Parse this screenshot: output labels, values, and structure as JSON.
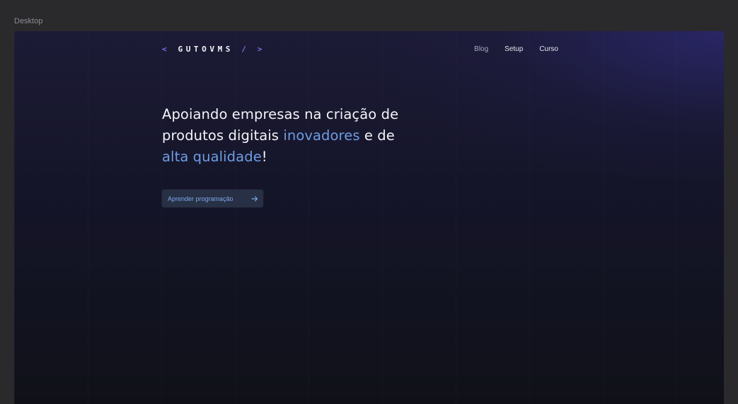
{
  "frame": {
    "label": "Desktop"
  },
  "header": {
    "logo": {
      "open_bracket": "<",
      "name": "GUTOVMS",
      "close_bracket": "/ >"
    },
    "nav": [
      {
        "label": "Blog"
      },
      {
        "label": "Setup"
      },
      {
        "label": "Curso"
      }
    ]
  },
  "hero": {
    "line1": "Apoiando empresas na criação de",
    "line2_start": "produtos digitais ",
    "line2_accent": "inovadores",
    "line2_end": " e de",
    "line3_accent": "alta qualidade",
    "line3_end": "!"
  },
  "cta": {
    "label": "Aprender programação",
    "icon": "arrow-right-icon"
  },
  "colors": {
    "accent_text": "#6f9de4",
    "logo_bracket": "#8a6cf0",
    "button_bg": "#273044",
    "button_text": "#7fa7ea",
    "frame_bg": "#2a2a2d"
  }
}
